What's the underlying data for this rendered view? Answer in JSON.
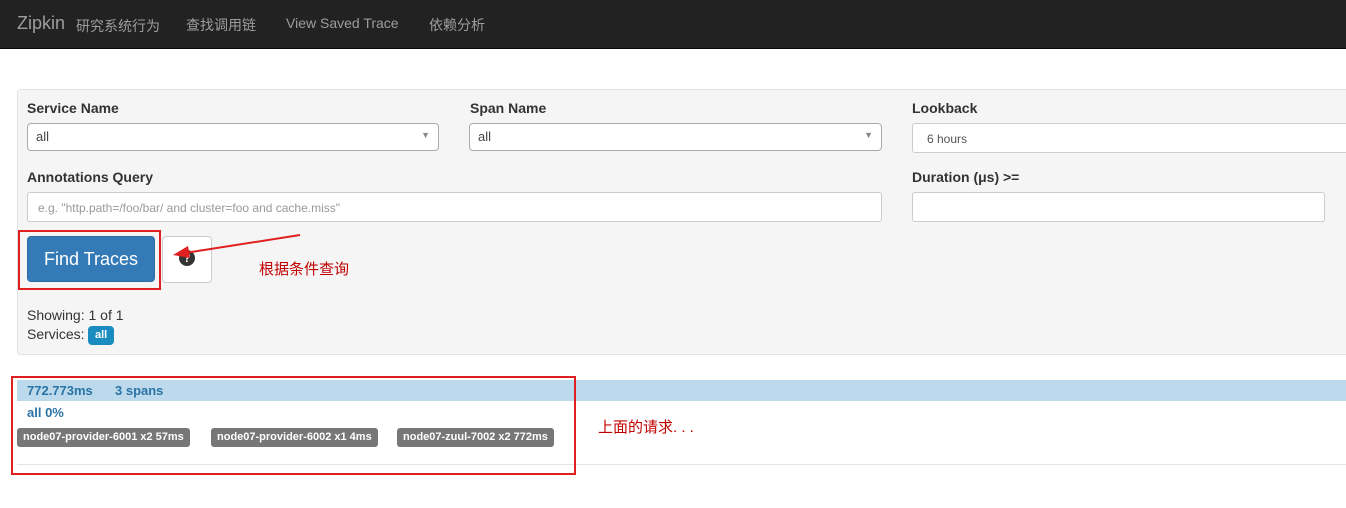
{
  "navbar": {
    "brand": "Zipkin",
    "brand_sub": "研究系统行为",
    "links": [
      "查找调用链",
      "View Saved Trace",
      "依赖分析"
    ]
  },
  "search": {
    "service_name_label": "Service Name",
    "service_name_value": "all",
    "span_name_label": "Span Name",
    "span_name_value": "all",
    "lookback_label": "Lookback",
    "lookback_value": "6 hours",
    "annotations_label": "Annotations Query",
    "annotations_placeholder": "e.g. \"http.path=/foo/bar/ and cluster=foo and cache.miss\"",
    "duration_label": "Duration (μs) >=",
    "duration_value": "",
    "find_button": "Find Traces",
    "help_glyph": "?"
  },
  "results": {
    "showing": "Showing: 1 of 1",
    "services_label": "Services:",
    "services_badge": "all"
  },
  "trace": {
    "duration": "772.773ms",
    "spans": "3 spans",
    "service_pct": "all 0%",
    "services": [
      "node07-provider-6001 x2 57ms",
      "node07-provider-6002 x1 4ms",
      "node07-zuul-7002 x2 772ms"
    ]
  },
  "annotations": {
    "query_note": "根据条件查询",
    "result_note": "上面的请求. . ."
  },
  "colors": {
    "navbar_bg": "#222222",
    "primary": "#337ab7",
    "trace_header": "#bcdaeb",
    "highlight": "#e02020"
  }
}
